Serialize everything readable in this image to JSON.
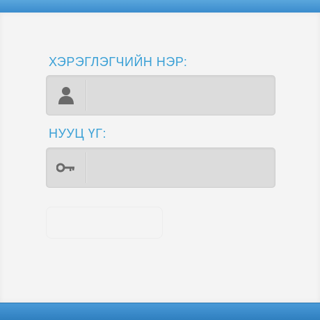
{
  "form": {
    "username_label": "ХЭРЭГЛЭГЧИЙН НЭР:",
    "username_value": "",
    "password_label": "НУУЦ ҮГ:",
    "password_value": "",
    "submit_label": ""
  },
  "icons": {
    "username": "user-icon",
    "password": "key-icon"
  },
  "colors": {
    "accent": "#3aa0d6",
    "top_bar": "#4a9ad8",
    "bottom_bar": "#2f7fbf",
    "field_bg": "#dcdcdc",
    "panel_bg": "#f4f4f4"
  }
}
